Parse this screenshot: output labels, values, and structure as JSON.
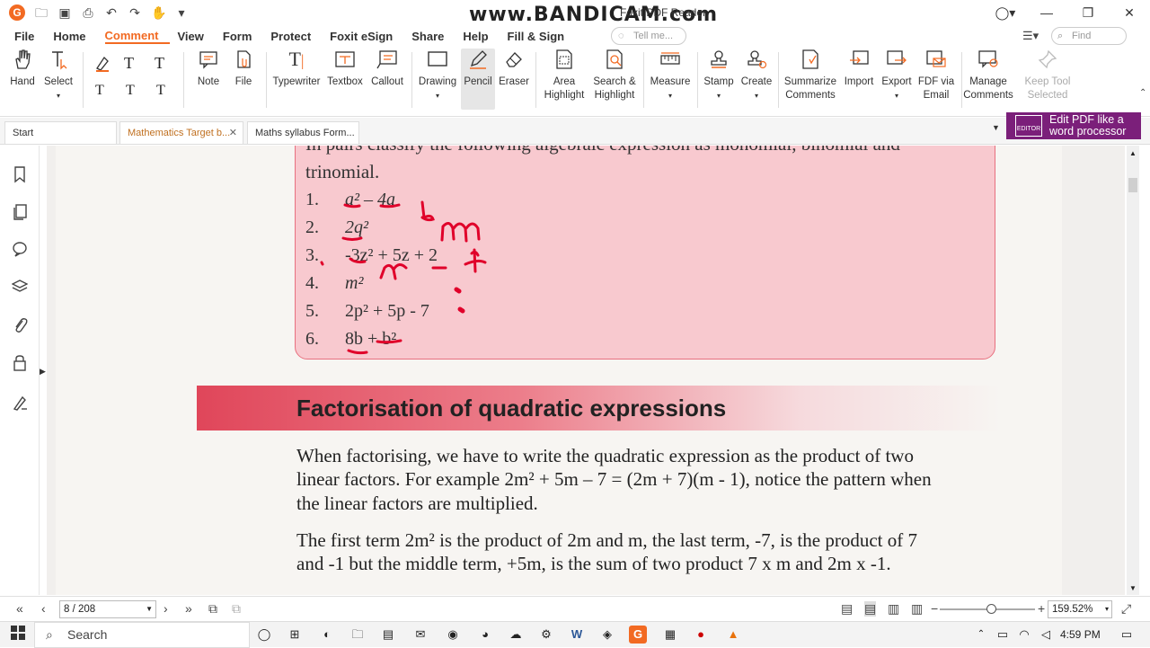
{
  "window": {
    "title": "Foxit PDF Reader",
    "watermark": "www.BANDICAM.com",
    "controls": [
      "user-circle",
      "minimize",
      "restore",
      "close"
    ]
  },
  "menu": {
    "items": [
      "File",
      "Home",
      "Comment",
      "View",
      "Form",
      "Protect",
      "Foxit eSign",
      "Share",
      "Help",
      "Fill & Sign"
    ],
    "active": "Comment",
    "tell_me_placeholder": "Tell me...",
    "find_placeholder": "Find"
  },
  "ribbon": {
    "hand": "Hand",
    "select": "Select",
    "note": "Note",
    "file": "File",
    "typewriter": "Typewriter",
    "textbox": "Textbox",
    "callout": "Callout",
    "drawing": "Drawing",
    "pencil": "Pencil",
    "eraser": "Eraser",
    "area_highlight_1": "Area",
    "area_highlight_2": "Highlight",
    "search_highlight_1": "Search &",
    "search_highlight_2": "Highlight",
    "measure": "Measure",
    "stamp": "Stamp",
    "create": "Create",
    "summarize_1": "Summarize",
    "summarize_2": "Comments",
    "import": "Import",
    "export": "Export",
    "fdf_1": "FDF via",
    "fdf_2": "Email",
    "manage_1": "Manage",
    "manage_2": "Comments",
    "keeptool_1": "Keep Tool",
    "keeptool_2": "Selected"
  },
  "tabs": {
    "start": "Start",
    "doc1": "Mathematics Target b...",
    "doc2": "Maths syllabus Form...",
    "edit_pdf_1": "Edit PDF like a",
    "edit_pdf_2": "word processor",
    "edit_logo": "EDITOR"
  },
  "document": {
    "intro_line1": "In pairs classify the following algebraic expression as monomial, binomial and",
    "intro_line2": "trinomial.",
    "list": [
      {
        "num": "1.",
        "expr": "a² – 4a"
      },
      {
        "num": "2.",
        "expr": "2q²"
      },
      {
        "num": "3.",
        "expr": "-3z² + 5z + 2"
      },
      {
        "num": "4.",
        "expr": "m²"
      },
      {
        "num": "5.",
        "expr": "2p² + 5p - 7"
      },
      {
        "num": "6.",
        "expr": "8b + b²"
      }
    ],
    "heading": "Factorisation of quadratic expressions",
    "para1_line1": "When factorising, we have to write the quadratic expression as the product of two",
    "para1_line2": "linear factors. For example 2m² + 5m – 7 = (2m + 7)(m - 1), notice the pattern when",
    "para1_line3": "the linear factors are multiplied.",
    "para2_line1": "The first term 2m² is the product of 2m and m, the last term, -7, is the product of 7",
    "para2_line2": "and -1 but the middle term, +5m, is the sum of two product 7 x m and 2m x -1."
  },
  "status": {
    "page": "8 / 208",
    "zoom": "159.52%",
    "zoom_fraction": 0.55
  },
  "taskbar": {
    "search": "Search",
    "time": "4:59 PM"
  },
  "colors": {
    "accent": "#f26a22",
    "box_fill": "#f8c9cf",
    "heading_band": "#e0465a",
    "ink": "#e0002a",
    "edit_banner": "#7b1f7a"
  }
}
